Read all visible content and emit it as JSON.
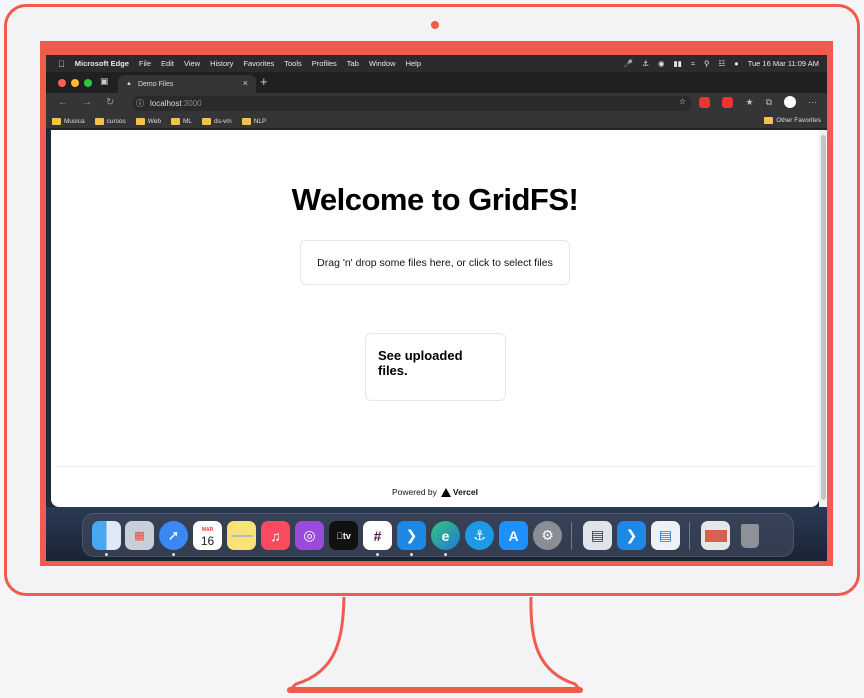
{
  "menubar": {
    "app_name": "Microsoft Edge",
    "menus": [
      "File",
      "Edit",
      "View",
      "History",
      "Favorites",
      "Tools",
      "Profiles",
      "Tab",
      "Window",
      "Help"
    ],
    "clock": "Tue 16 Mar  11:09 AM"
  },
  "browser": {
    "tab_title": "Demo Files",
    "tab_close": "×",
    "new_tab": "+",
    "url_host": "localhost",
    "url_port": ":3000",
    "more": "···"
  },
  "bookmarks": {
    "items": [
      "Musica",
      "cursos",
      "Web",
      "ML",
      "ds-vm",
      "NLP"
    ],
    "other": "Other Favorites"
  },
  "page": {
    "title": "Welcome to GridFS!",
    "dropzone_text": "Drag 'n' drop some files here, or click to select files",
    "card_text": "See uploaded files.",
    "footer_prefix": "Powered by",
    "footer_brand": "Vercel"
  },
  "dock": {
    "calendar_month": "MAR",
    "calendar_day": "16",
    "tv_label": "tv",
    "icons": [
      "finder-icon",
      "launchpad-icon",
      "safari-icon",
      "calendar-icon",
      "notes-icon",
      "music-icon",
      "podcasts-icon",
      "tv-icon",
      "slack-icon",
      "vscode-icon",
      "edge-icon",
      "docker-icon",
      "app-store-icon",
      "system-preferences-icon",
      "preview-icon",
      "vscode-icon",
      "keynote-icon",
      "folder-icon",
      "trash-icon"
    ]
  },
  "colors": {
    "frame": "#ef5b4c",
    "page_bg": "#ffffff",
    "dock_bg": "#3c465a"
  }
}
